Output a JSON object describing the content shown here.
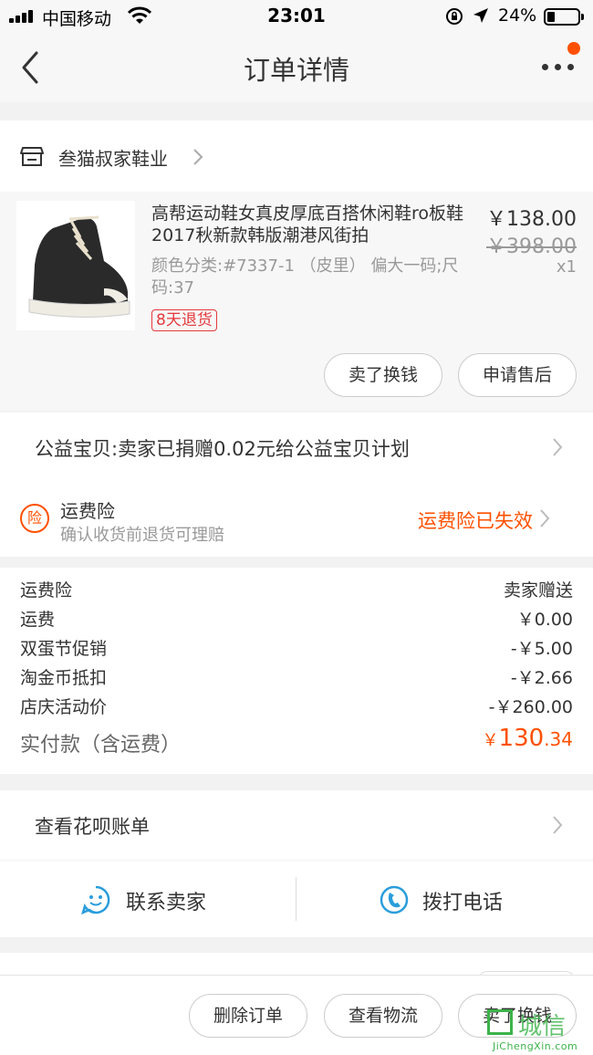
{
  "status_bar": {
    "carrier": "中国移动",
    "time": "23:01",
    "battery": "24%"
  },
  "nav": {
    "title": "订单详情"
  },
  "shop": {
    "name": "叁猫叔家鞋业"
  },
  "product": {
    "name": "高帮运动鞋女真皮厚底百搭休闲鞋ro板鞋2017秋新款韩版潮港风街拍",
    "sku": "颜色分类:#7337-1 （皮里） 偏大一码;尺码:37",
    "tag": "8天退货",
    "price": "￥138.00",
    "original_price": "￥398.00",
    "quantity": "x1",
    "buttons": [
      "卖了换钱",
      "申请售后"
    ]
  },
  "charity": {
    "text": "公益宝贝:卖家已捐赠0.02元给公益宝贝计划"
  },
  "insurance": {
    "badge": "险",
    "title": "运费险",
    "subtitle": "确认收货前退货可理赔",
    "status": "运费险已失效"
  },
  "fees": {
    "rows": [
      {
        "label": "运费险",
        "value": "卖家赠送"
      },
      {
        "label": "运费",
        "value": "￥0.00"
      },
      {
        "label": "双蛋节促销",
        "value": "-￥5.00"
      },
      {
        "label": "淘金币抵扣",
        "value": "-￥2.66"
      },
      {
        "label": "店庆活动价",
        "value": "-￥260.00"
      }
    ],
    "total_label": "实付款（含运费）",
    "total_currency": "￥",
    "total_integer": "130",
    "total_decimal": ".34"
  },
  "huabei": {
    "text": "查看花呗账单"
  },
  "contact": {
    "seller": "联系卖家",
    "phone": "拨打电话"
  },
  "bottom_bar": {
    "buttons": [
      "删除订单",
      "查看物流",
      "卖了换钱"
    ]
  },
  "watermark": {
    "cn": "城信",
    "en": "JiChengXin.com"
  },
  "colors": {
    "accent": "#ff5000",
    "tag_red": "#e4393c",
    "icon_blue": "#2a9ddb"
  }
}
